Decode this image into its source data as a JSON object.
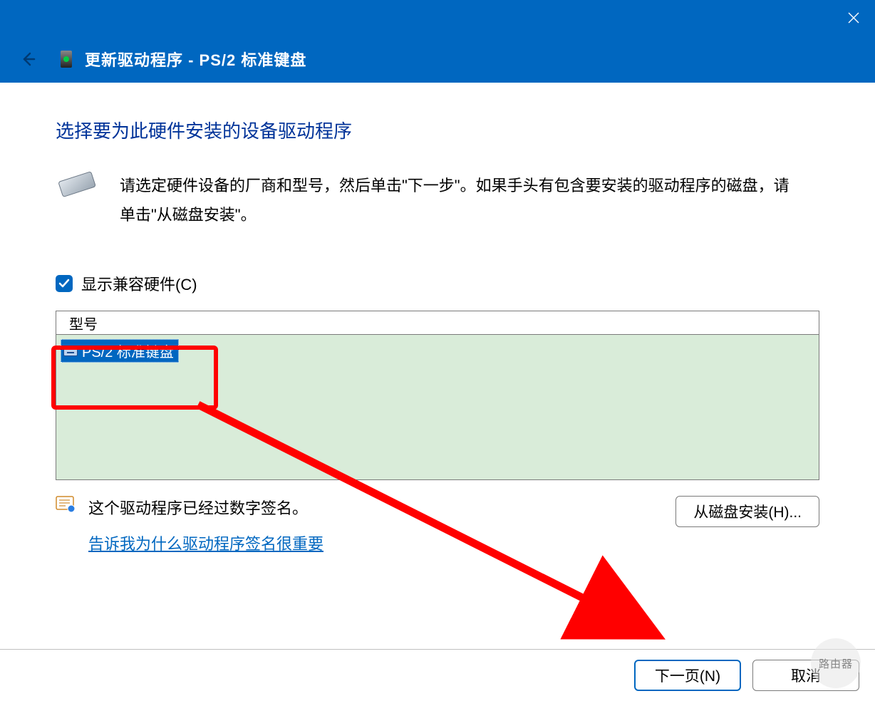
{
  "titlebar": {},
  "header": {
    "title": "更新驱动程序 - PS/2 标准键盘"
  },
  "section": {
    "heading": "选择要为此硬件安装的设备驱动程序",
    "instruction": "请选定硬件设备的厂商和型号，然后单击\"下一步\"。如果手头有包含要安装的驱动程序的磁盘，请单击\"从磁盘安装\"。"
  },
  "checkbox": {
    "label": "显示兼容硬件(C)",
    "checked": true
  },
  "listbox": {
    "column_header": "型号",
    "items": [
      "PS/2 标准键盘"
    ]
  },
  "signature": {
    "text": "这个驱动程序已经过数字签名。",
    "link": "告诉我为什么驱动程序签名很重要"
  },
  "buttons": {
    "from_disk": "从磁盘安装(H)...",
    "next": "下一页(N)",
    "cancel": "取消"
  },
  "watermark": "路由器"
}
